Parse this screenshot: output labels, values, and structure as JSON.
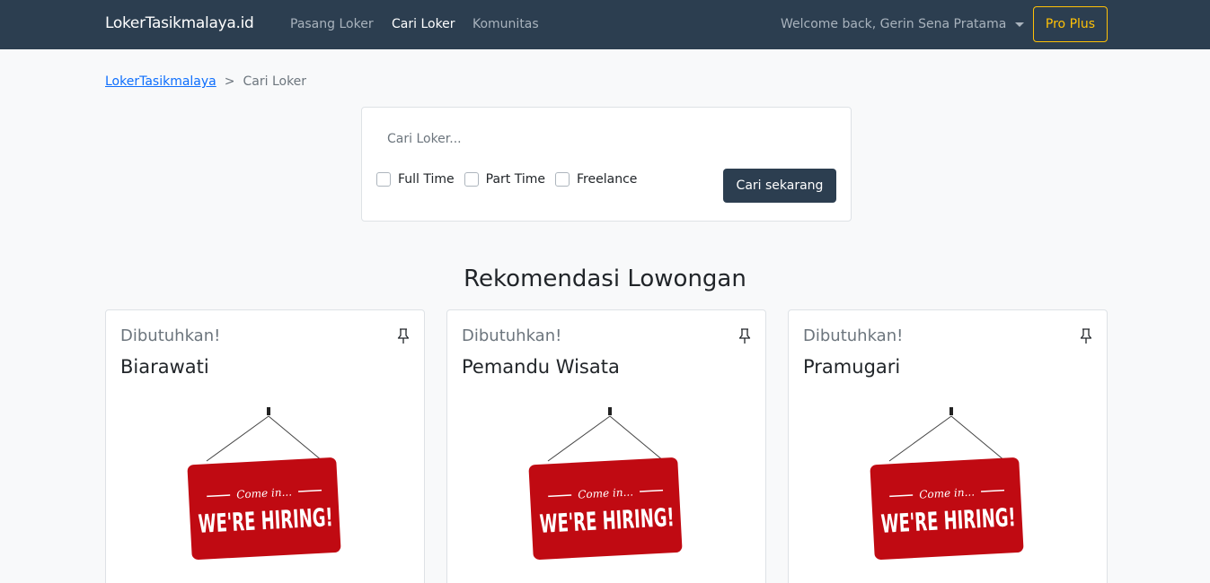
{
  "navbar": {
    "brand": "LokerTasikmalaya.id",
    "links": [
      "Pasang Loker",
      "Cari Loker",
      "Komunitas"
    ],
    "user_greeting": "Welcome back, Gerin Sena Pratama",
    "pro_label": "Pro Plus",
    "pro_color": "#ffc107",
    "bg_color": "#2c3e50"
  },
  "breadcrumb": {
    "home": "LokerTasikmalaya",
    "separator": ">",
    "current": "Cari Loker"
  },
  "search": {
    "placeholder": "Cari Loker...",
    "value": "",
    "filters": [
      "Full Time",
      "Part Time",
      "Freelance"
    ],
    "button_label": "Cari sekarang"
  },
  "recommendations": {
    "title": "Rekomendasi Lowongan",
    "jobs": [
      {
        "label": "Dibutuhkan!",
        "title": "Biarawati",
        "sign_small": "Come in...",
        "sign_big": "WE'RE HIRING!"
      },
      {
        "label": "Dibutuhkan!",
        "title": "Pemandu Wisata",
        "sign_small": "Come in...",
        "sign_big": "WE'RE HIRING!"
      },
      {
        "label": "Dibutuhkan!",
        "title": "Pramugari",
        "sign_small": "Come in...",
        "sign_big": "WE'RE HIRING!"
      }
    ]
  }
}
